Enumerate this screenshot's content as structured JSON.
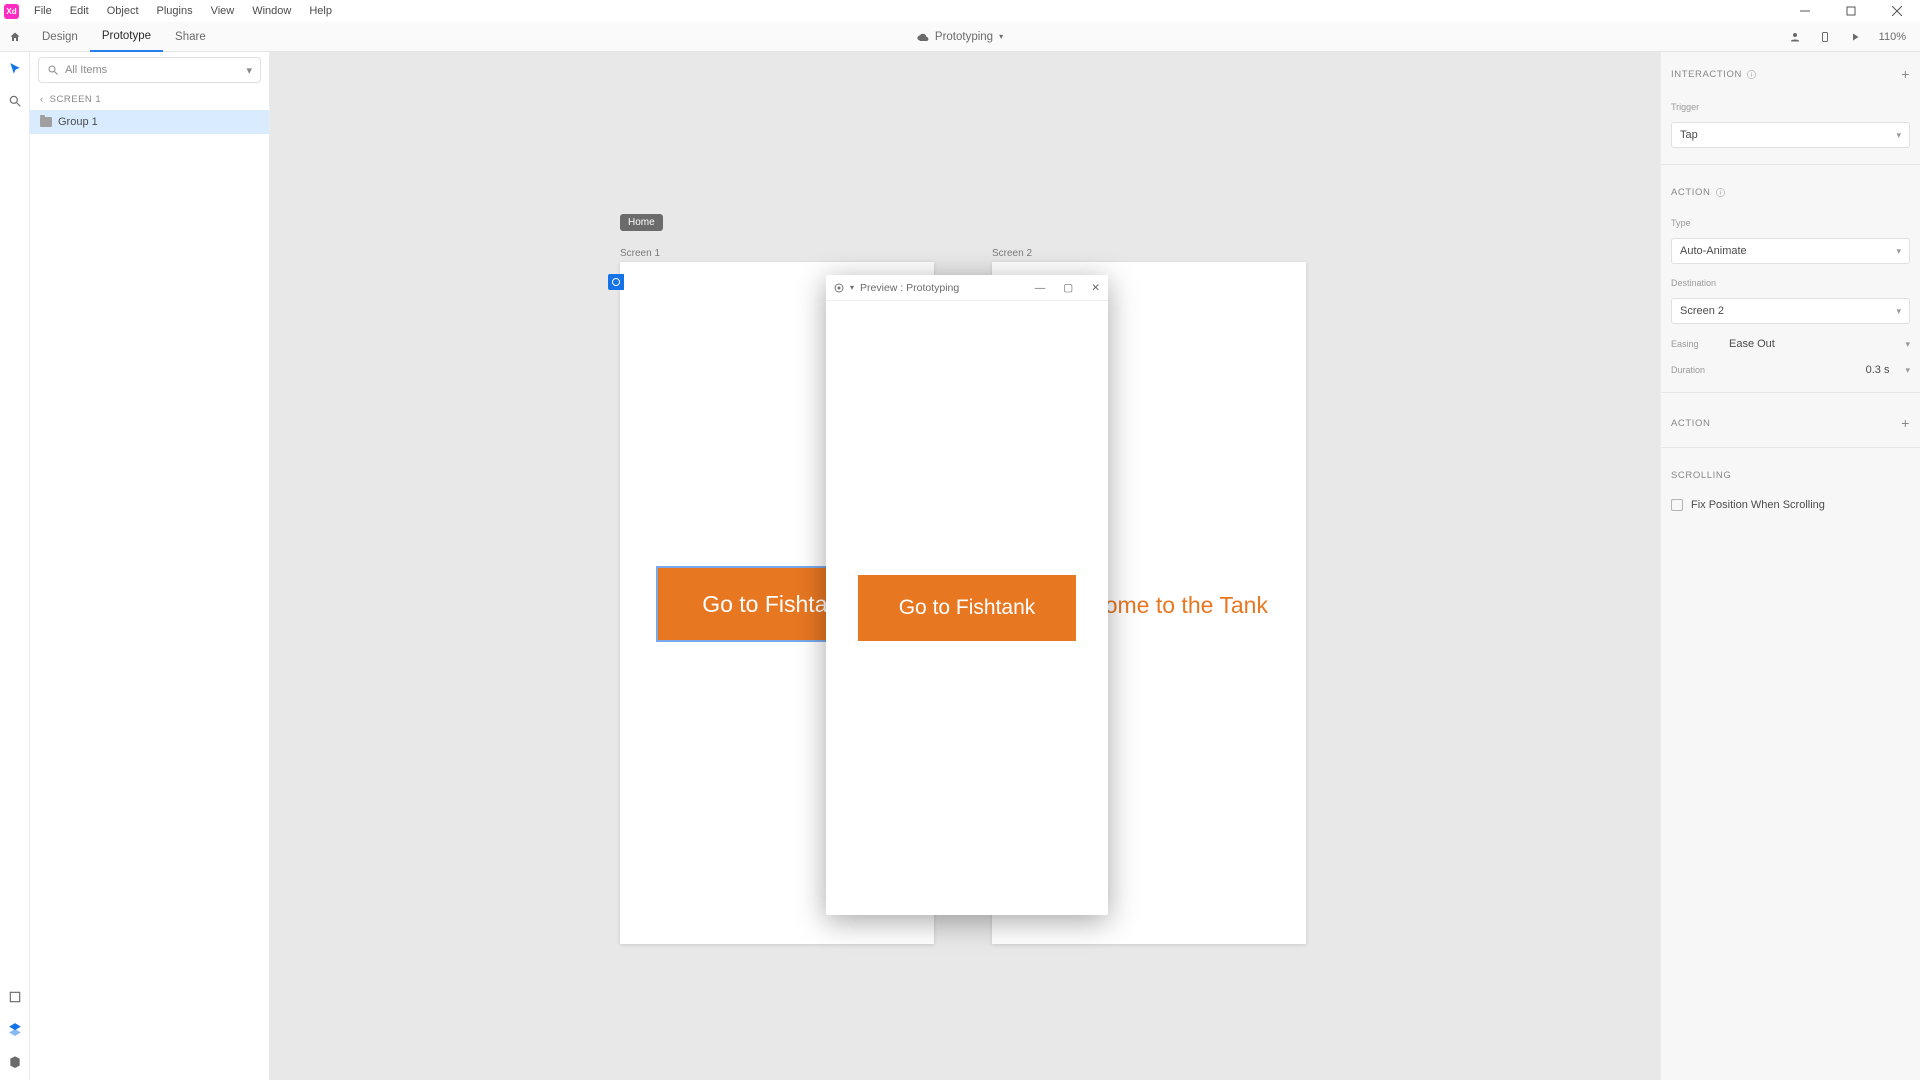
{
  "app_badge": "Xd",
  "menu": {
    "file": "File",
    "edit": "Edit",
    "object": "Object",
    "plugins": "Plugins",
    "view": "View",
    "window": "Window",
    "help": "Help"
  },
  "tabs": {
    "design": "Design",
    "prototype": "Prototype",
    "share": "Share"
  },
  "doc_name": "Prototyping",
  "zoom": "110%",
  "layers": {
    "search_placeholder": "All Items",
    "breadcrumb": "SCREEN 1",
    "items": [
      "Group 1"
    ]
  },
  "canvas": {
    "home_chip": "Home",
    "artboard1_label": "Screen 1",
    "artboard2_label": "Screen 2",
    "button1_text": "Go to Fishtank",
    "screen2_text": "Welcome to the Tank"
  },
  "preview": {
    "title": "Preview : Prototyping",
    "button_text": "Go to Fishtank"
  },
  "inspector": {
    "interaction_head": "INTERACTION",
    "trigger_label": "Trigger",
    "trigger_value": "Tap",
    "action_head": "ACTION",
    "type_label": "Type",
    "type_value": "Auto-Animate",
    "dest_label": "Destination",
    "dest_value": "Screen 2",
    "easing_label": "Easing",
    "easing_value": "Ease Out",
    "duration_label": "Duration",
    "duration_value": "0.3 s",
    "action2_head": "ACTION",
    "scrolling_head": "SCROLLING",
    "fix_label": "Fix Position When Scrolling"
  }
}
